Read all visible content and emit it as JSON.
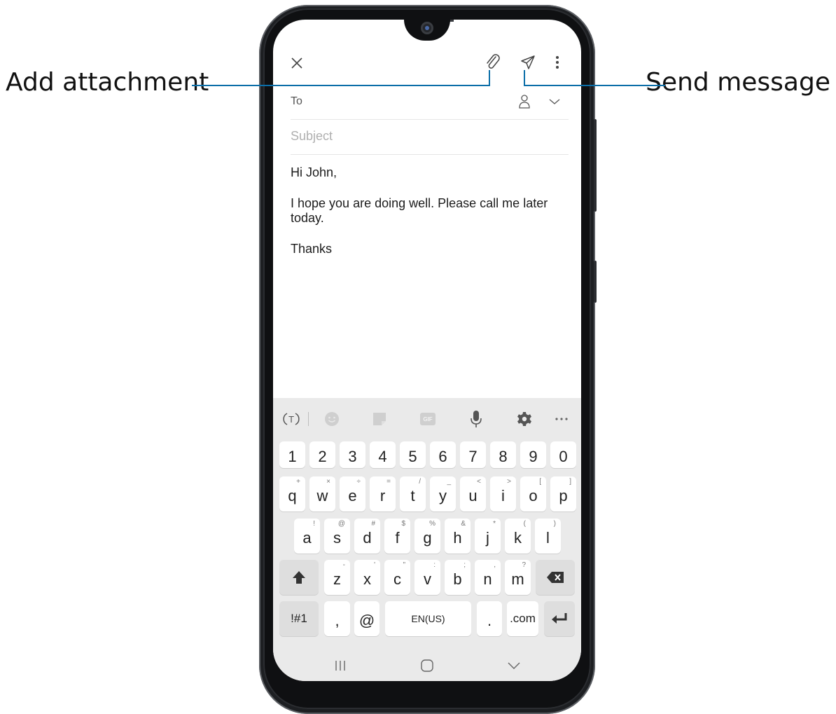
{
  "callouts": {
    "attachment": "Add attachment",
    "send": "Send message"
  },
  "email": {
    "to_label": "To",
    "subject_placeholder": "Subject",
    "greeting": "Hi John,",
    "line1": "I hope you are doing well. Please call me later",
    "line2": "today.",
    "signoff": "Thanks"
  },
  "toolbar_icons": [
    "close-icon",
    "attachment-icon",
    "send-icon",
    "more-options-icon",
    "contact-icon",
    "chevron-down-icon"
  ],
  "keyboard": {
    "toolbar": [
      "translate-icon",
      "emoji-icon",
      "sticker-icon",
      "gif-icon",
      "microphone-icon",
      "settings-icon",
      "more-icon"
    ],
    "gif_label": "GIF",
    "number_row": [
      "1",
      "2",
      "3",
      "4",
      "5",
      "6",
      "7",
      "8",
      "9",
      "0"
    ],
    "row1": [
      "q",
      "w",
      "e",
      "r",
      "t",
      "y",
      "u",
      "i",
      "o",
      "p"
    ],
    "row1_hints": [
      "+",
      "×",
      "÷",
      "=",
      "/",
      "_",
      "<",
      ">",
      "[",
      "]"
    ],
    "row2": [
      "a",
      "s",
      "d",
      "f",
      "g",
      "h",
      "j",
      "k",
      "l"
    ],
    "row2_hints": [
      "!",
      "@",
      "#",
      "$",
      "%",
      "&",
      "*",
      "(",
      ")"
    ],
    "row3": [
      "z",
      "x",
      "c",
      "v",
      "b",
      "n",
      "m"
    ],
    "row3_hints": [
      "-",
      "'",
      "\"",
      ":",
      ";",
      ",",
      "?"
    ],
    "symbols_key": "!#1",
    "comma_key": ",",
    "at_key": "@",
    "space_key": "EN(US)",
    "period_key": ".",
    "dotcom_key": ".com"
  },
  "nav_icons": [
    "recents-icon",
    "home-icon",
    "back-icon"
  ],
  "colors": {
    "callout_line": "#0b6ea8",
    "keyboard_bg": "#eaeaea",
    "key_bg": "#ffffff"
  }
}
